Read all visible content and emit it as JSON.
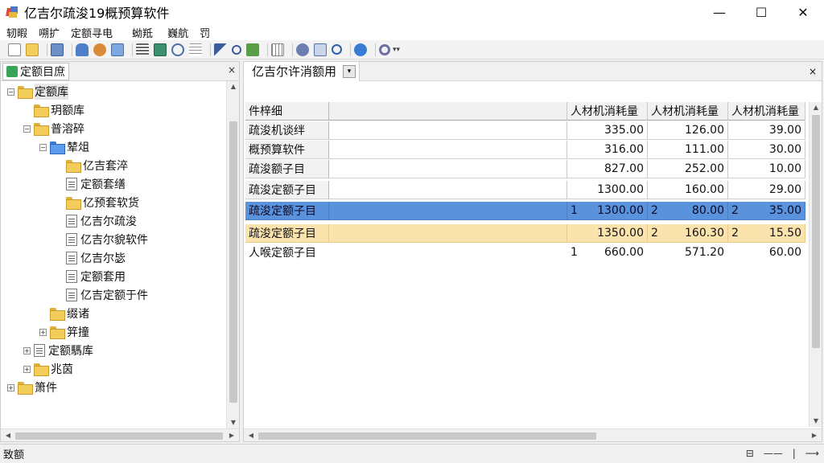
{
  "window": {
    "title": "亿吉尔疏浚19概预算软件",
    "controls": {
      "minimize": "—",
      "maximize": "☐",
      "close": "✕"
    }
  },
  "menubar": {
    "items": [
      "轫暇",
      "嗍扩",
      "定额寻电",
      "蚴羝",
      "巍航",
      "罚"
    ]
  },
  "toolbar": {
    "buttons": [
      "new-icon",
      "open-icon",
      "save-icon",
      "db-icon",
      "link-icon",
      "export-icon",
      "list-icon",
      "calc-icon",
      "zoom-icon",
      "lines-icon",
      "pointer-icon",
      "search-icon",
      "tree-icon",
      "grid-icon",
      "tool-icon",
      "report-icon",
      "find-icon",
      "globe-icon",
      "settings-icon"
    ]
  },
  "left_panel": {
    "tab_label": "定额目庶",
    "close": "×",
    "tree": [
      {
        "label": "定额库",
        "level": 0,
        "icon": "folder",
        "expander": "−",
        "selected": true
      },
      {
        "label": "玥额库",
        "level": 1,
        "icon": "folder"
      },
      {
        "label": "普溶碎",
        "level": 1,
        "icon": "folder-open",
        "expander": "−"
      },
      {
        "label": "辇俎",
        "level": 2,
        "icon": "folder-blue",
        "expander": "−"
      },
      {
        "label": "亿吉套淬",
        "level": 3,
        "icon": "folder"
      },
      {
        "label": "定额套缮",
        "level": 3,
        "icon": "doc"
      },
      {
        "label": "亿预套软货",
        "level": 3,
        "icon": "folder-open"
      },
      {
        "label": "亿吉尔疏浚",
        "level": 3,
        "icon": "doc"
      },
      {
        "label": "亿吉尔貌软件",
        "level": 3,
        "icon": "doc"
      },
      {
        "label": "亿吉尔毖",
        "level": 3,
        "icon": "doc"
      },
      {
        "label": "定额套用",
        "level": 3,
        "icon": "doc-small"
      },
      {
        "label": "亿吉定额于件",
        "level": 3,
        "icon": "doc"
      },
      {
        "label": "缀诸",
        "level": 2,
        "icon": "folder-empty"
      },
      {
        "label": "笄撞",
        "level": 2,
        "icon": "folder-open",
        "expander": "+"
      },
      {
        "label": "定额騳库",
        "level": 1,
        "icon": "doc",
        "expander": "+"
      },
      {
        "label": "兆茵",
        "level": 1,
        "icon": "folder",
        "expander": "+"
      },
      {
        "label": "箫件",
        "level": 0,
        "icon": "folder",
        "expander": "+"
      }
    ]
  },
  "right_panel": {
    "tab_label": "亿吉尔许消额用",
    "dropdown": "▾",
    "close": "×",
    "table": {
      "headers": [
        "件梓细",
        "",
        "人材机消耗量",
        "人材机消耗量",
        "人材机消耗量"
      ],
      "rows": [
        {
          "name": "疏浚机谈绊",
          "a_idx": "",
          "a": "335.00",
          "b_idx": "",
          "b": "126.00",
          "c_idx": "",
          "c": "39.00",
          "style": "normal"
        },
        {
          "name": "概预算软件",
          "a_idx": "",
          "a": "316.00",
          "b_idx": "",
          "b": "111.00",
          "c_idx": "",
          "c": "30.00",
          "style": "normal"
        },
        {
          "name": "疏浚额子目",
          "a_idx": "",
          "a": "827.00",
          "b_idx": "",
          "b": "252.00",
          "c_idx": "",
          "c": "10.00",
          "style": "normal"
        },
        {
          "name": "疏浚定额子目",
          "a_idx": "",
          "a": "1300.00",
          "b_idx": "",
          "b": "160.00",
          "c_idx": "",
          "c": "29.00",
          "style": "normal"
        },
        {
          "name": "疏浚定额子目",
          "a_idx": "1",
          "a": "1300.00",
          "b_idx": "2",
          "b": "80.00",
          "c_idx": "2",
          "c": "35.00",
          "style": "selected"
        },
        {
          "name": "疏浚定额子目",
          "a_idx": "",
          "a": "1350.00",
          "b_idx": "2",
          "b": "160.30",
          "c_idx": "2",
          "c": "15.50",
          "style": "highlight"
        },
        {
          "name": "人喉定额子目",
          "a_idx": "1",
          "a": "660.00",
          "b_idx": "",
          "b": "571.20",
          "c_idx": "",
          "c": "60.00",
          "style": "plain"
        }
      ]
    }
  },
  "statusbar": {
    "text": "致额",
    "right_items": [
      "⊟",
      "——",
      "|",
      "⟶"
    ]
  },
  "colors": {
    "selected_row": "#5a93db",
    "highlight_row": "#fbe3ad",
    "folder": "#f3cd5a"
  }
}
